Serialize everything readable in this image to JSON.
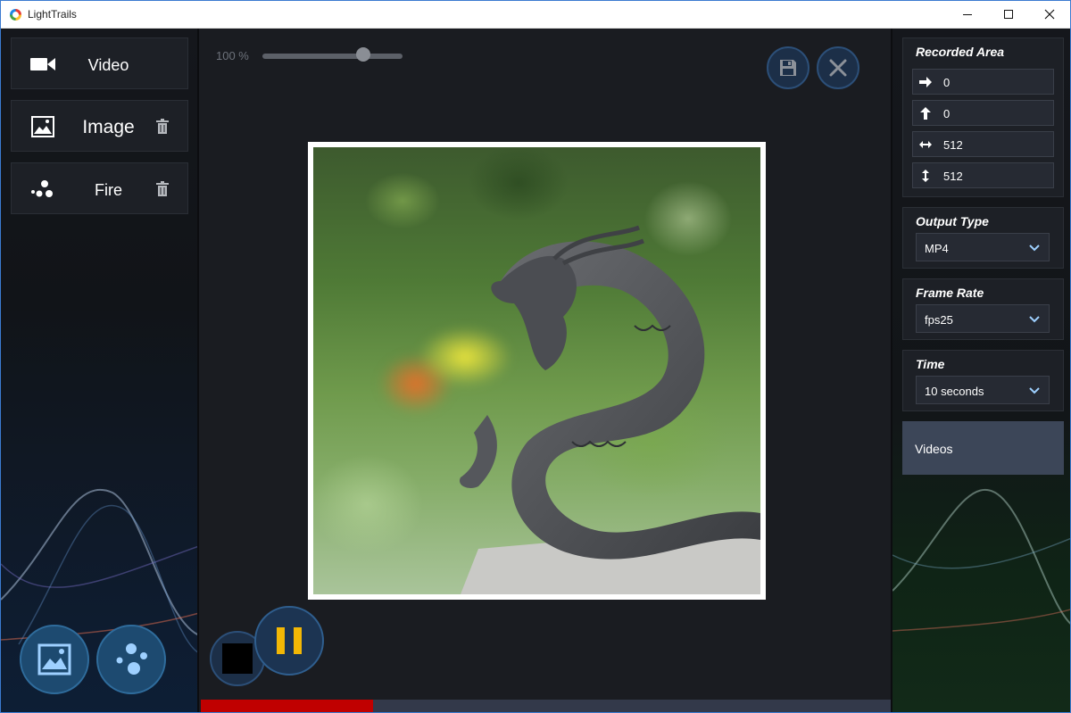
{
  "window": {
    "title": "LightTrails"
  },
  "sources": [
    {
      "label": "Video",
      "icon": "video-camera-icon",
      "deletable": false
    },
    {
      "label": "Image",
      "icon": "image-icon",
      "deletable": true
    },
    {
      "label": "Fire",
      "icon": "particles-icon",
      "deletable": true
    }
  ],
  "add_buttons": [
    {
      "icon": "add-image-icon"
    },
    {
      "icon": "add-particles-icon"
    }
  ],
  "toolbar": {
    "zoom_label": "100 %",
    "zoom_level": 0.72,
    "save_icon": "save-icon",
    "close_icon": "close-icon"
  },
  "playback": {
    "stop_icon": "stop-icon",
    "pause_icon": "pause-icon",
    "pause_color": "#f2b705",
    "progress": 0.25
  },
  "recorded_area": {
    "title": "Recorded Area",
    "x": "0",
    "y": "0",
    "width": "512",
    "height": "512"
  },
  "output_type": {
    "title": "Output Type",
    "value": "MP4"
  },
  "frame_rate": {
    "title": "Frame Rate",
    "value": "fps25"
  },
  "time": {
    "title": "Time",
    "value": "10 seconds"
  },
  "videos_button": {
    "label": "Videos"
  },
  "colors": {
    "accent": "#2f6c9c",
    "progress": "#c00000",
    "icon_light": "#9ed0ff"
  }
}
